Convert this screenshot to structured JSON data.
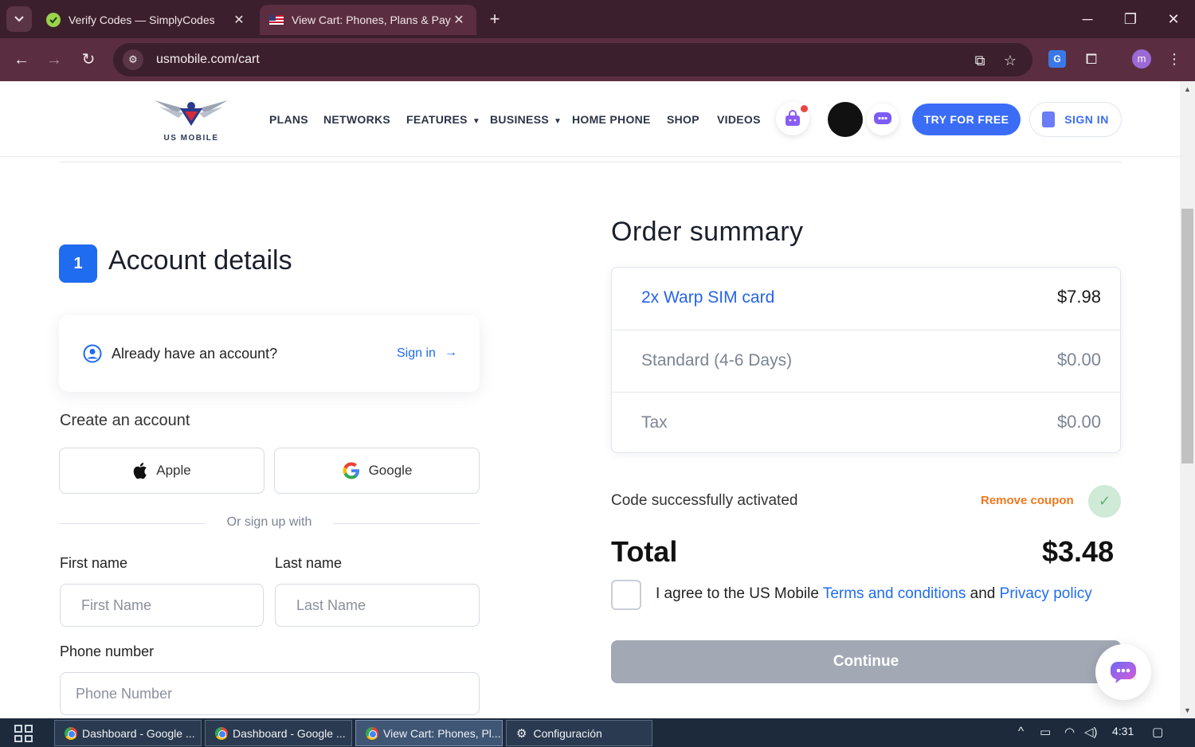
{
  "browser": {
    "tabs": [
      {
        "title": "Verify Codes — SimplyCodes",
        "close": "✕"
      },
      {
        "title": "View Cart: Phones, Plans & Payments",
        "close": "✕"
      }
    ],
    "new_tab": "+",
    "url": "usmobile.com/cart",
    "profile_initial": "m"
  },
  "header": {
    "logo_text": "US MOBILE",
    "nav": [
      "PLANS",
      "NETWORKS",
      "FEATURES",
      "BUSINESS",
      "HOME PHONE",
      "SHOP",
      "VIDEOS"
    ],
    "try_label": "TRY FOR FREE",
    "signin_label": "SIGN IN"
  },
  "account": {
    "step": "1",
    "title": "Account details",
    "have_account": "Already have an account?",
    "signin_link": "Sign in",
    "create_label": "Create an account",
    "apple_label": "Apple",
    "google_label": "Google",
    "or_text": "Or sign up with",
    "first_name_label": "First name",
    "first_name_placeholder": "First Name",
    "last_name_label": "Last name",
    "last_name_placeholder": "Last Name",
    "phone_label": "Phone number",
    "phone_placeholder": "Phone Number"
  },
  "order": {
    "title": "Order summary",
    "items": [
      {
        "name": "2x Warp SIM card",
        "price": "$7.98",
        "name_color": "#2563eb"
      },
      {
        "name": "Standard (4-6 Days)",
        "price": "$0.00",
        "name_color": "#7b8494"
      },
      {
        "name": "Tax",
        "price": "$0.00",
        "name_color": "#7b8494"
      }
    ],
    "coupon_message": "Code successfully activated",
    "remove_coupon": "Remove coupon",
    "total_label": "Total",
    "total_value": "$3.48",
    "agree_prefix": "I agree to the US Mobile ",
    "terms_link": "Terms and conditions",
    "agree_and": " and ",
    "privacy_link": "Privacy policy",
    "continue_label": "Continue"
  },
  "taskbar": {
    "items": [
      "Dashboard - Google ...",
      "Dashboard - Google ...",
      "View Cart: Phones, Pl...",
      "Configuración"
    ],
    "time": "4:31"
  },
  "colors": {
    "brand_blue": "#1f6cf0",
    "try_button": "#3b6cf6",
    "coupon_orange": "#f0781e",
    "continue_disabled": "#a2a9b5"
  }
}
